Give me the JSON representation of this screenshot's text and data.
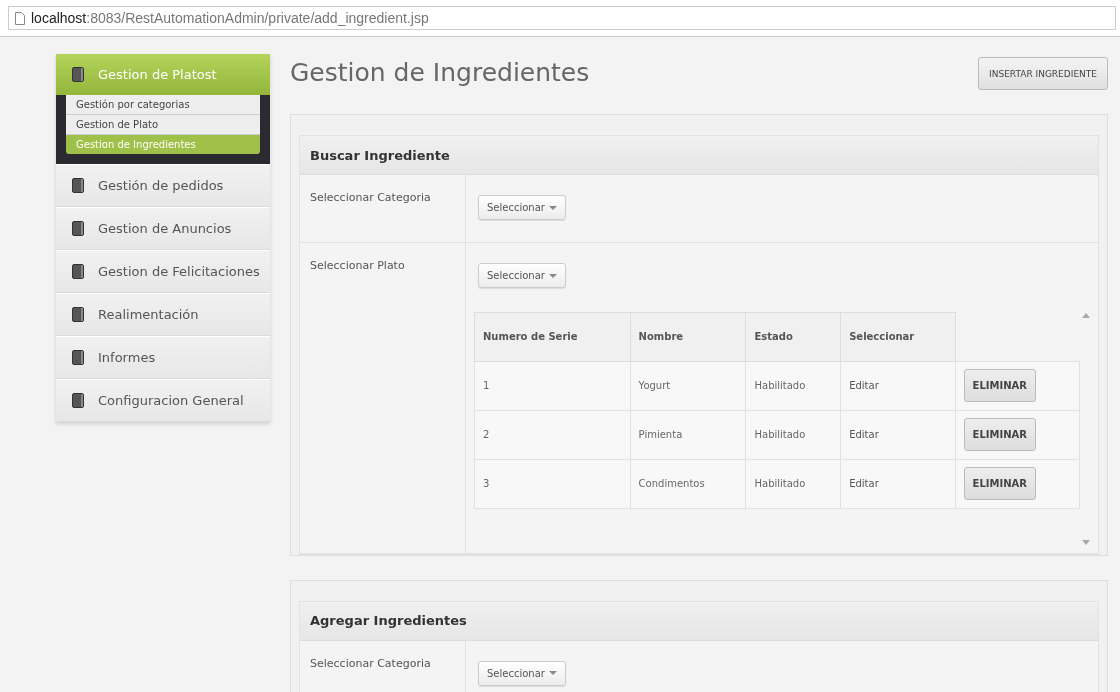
{
  "address_bar": {
    "host": "localhost",
    "path": ":8083/RestAutomationAdmin/private/add_ingredient.jsp"
  },
  "sidebar": {
    "items": [
      {
        "label": "Gestion de Platost",
        "selected": true,
        "expanded": true,
        "children": [
          {
            "label": "Gestión por categorias",
            "selected": false
          },
          {
            "label": "Gestion de Plato",
            "selected": false
          },
          {
            "label": "Gestion de Ingredientes",
            "selected": true
          }
        ]
      },
      {
        "label": "Gestión de pedidos",
        "selected": false
      },
      {
        "label": "Gestion de Anuncios",
        "selected": false
      },
      {
        "label": "Gestion de Felicitaciones",
        "selected": false
      },
      {
        "label": "Realimentación",
        "selected": false
      },
      {
        "label": "Informes",
        "selected": false
      },
      {
        "label": "Configuracion General",
        "selected": false
      }
    ]
  },
  "page": {
    "title": "Gestion de Ingredientes",
    "action_button": "INSERTAR INGREDIENTE"
  },
  "panels": [
    {
      "title": "Buscar Ingrediente",
      "rows": [
        {
          "label": "Seleccionar Categoria",
          "select": "Seleccionar"
        },
        {
          "label": "Seleccionar Plato",
          "select": "Seleccionar",
          "table": {
            "columns": [
              "Numero de Serie",
              "Nombre",
              "Estado",
              "Seleccionar"
            ],
            "rows": [
              {
                "cells": [
                  "1",
                  "Yogurt",
                  "Habilitado",
                  "Editar"
                ],
                "button": "ELIMINAR"
              },
              {
                "cells": [
                  "2",
                  "Pimienta",
                  "Habilitado",
                  "Editar"
                ],
                "button": "ELIMINAR"
              },
              {
                "cells": [
                  "3",
                  "Condimentos",
                  "Habilitado",
                  "Editar"
                ],
                "button": "ELIMINAR"
              }
            ]
          }
        }
      ]
    },
    {
      "title": "Agregar Ingredientes",
      "rows": [
        {
          "label": "Seleccionar Categoria",
          "select": "Seleccionar"
        }
      ]
    }
  ]
}
